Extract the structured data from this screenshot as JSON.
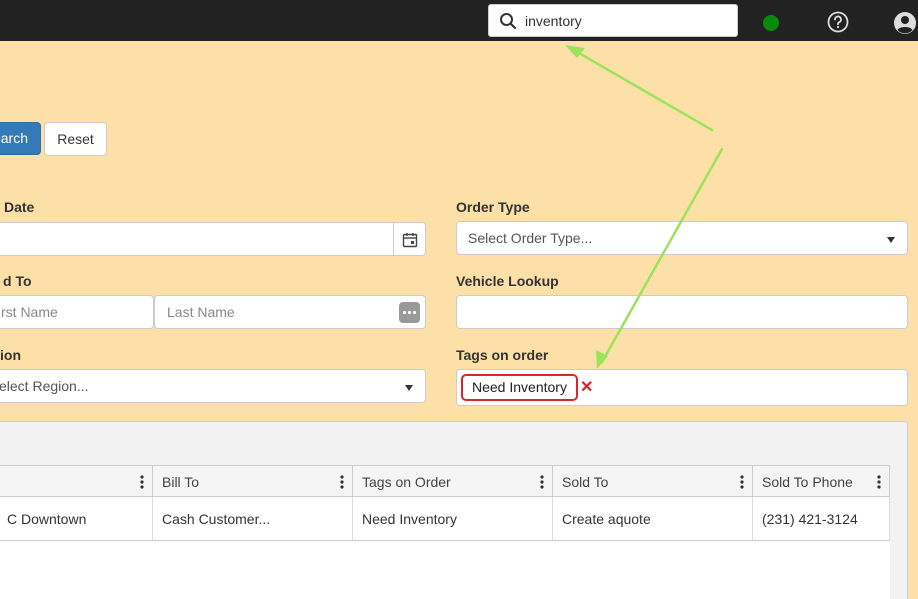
{
  "topbar": {
    "search_value": "inventory",
    "status_color": "#0a8a0a",
    "icons": [
      "search-icon",
      "status-online-icon",
      "help-icon",
      "user-icon"
    ]
  },
  "actions": {
    "search_label": "earch",
    "reset_label": "Reset"
  },
  "form": {
    "date_label": "Date",
    "order_type_label": "Order Type",
    "order_type_placeholder": "Select Order Type...",
    "sold_to_label": "d To",
    "first_name_placeholder": "rst Name",
    "last_name_placeholder": "Last Name",
    "vehicle_lookup_label": "Vehicle Lookup",
    "region_label": "ion",
    "region_placeholder": "elect Region...",
    "tags_label": "Tags on order",
    "tags": [
      {
        "text": "Need Inventory"
      }
    ]
  },
  "grid": {
    "columns": [
      "",
      "Bill To",
      "Tags on Order",
      "Sold To",
      "Sold To Phone"
    ],
    "rows": [
      [
        "C Downtown",
        "Cash Customer...",
        "Need Inventory",
        "Create aquote",
        "(231) 421-3124"
      ]
    ]
  },
  "colors": {
    "page_background": "#fde0a8",
    "topbar": "#222222",
    "primary_button": "#337ab7",
    "tag_border": "#d9262c",
    "annotation_arrow": "#9be35a"
  }
}
